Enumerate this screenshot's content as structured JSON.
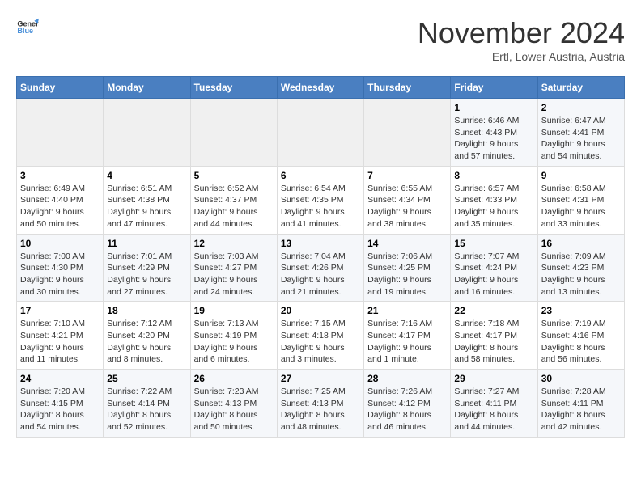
{
  "logo": {
    "line1": "General",
    "line2": "Blue"
  },
  "title": "November 2024",
  "subtitle": "Ertl, Lower Austria, Austria",
  "days_header": [
    "Sunday",
    "Monday",
    "Tuesday",
    "Wednesday",
    "Thursday",
    "Friday",
    "Saturday"
  ],
  "weeks": [
    [
      {
        "day": "",
        "info": ""
      },
      {
        "day": "",
        "info": ""
      },
      {
        "day": "",
        "info": ""
      },
      {
        "day": "",
        "info": ""
      },
      {
        "day": "",
        "info": ""
      },
      {
        "day": "1",
        "info": "Sunrise: 6:46 AM\nSunset: 4:43 PM\nDaylight: 9 hours and 57 minutes."
      },
      {
        "day": "2",
        "info": "Sunrise: 6:47 AM\nSunset: 4:41 PM\nDaylight: 9 hours and 54 minutes."
      }
    ],
    [
      {
        "day": "3",
        "info": "Sunrise: 6:49 AM\nSunset: 4:40 PM\nDaylight: 9 hours and 50 minutes."
      },
      {
        "day": "4",
        "info": "Sunrise: 6:51 AM\nSunset: 4:38 PM\nDaylight: 9 hours and 47 minutes."
      },
      {
        "day": "5",
        "info": "Sunrise: 6:52 AM\nSunset: 4:37 PM\nDaylight: 9 hours and 44 minutes."
      },
      {
        "day": "6",
        "info": "Sunrise: 6:54 AM\nSunset: 4:35 PM\nDaylight: 9 hours and 41 minutes."
      },
      {
        "day": "7",
        "info": "Sunrise: 6:55 AM\nSunset: 4:34 PM\nDaylight: 9 hours and 38 minutes."
      },
      {
        "day": "8",
        "info": "Sunrise: 6:57 AM\nSunset: 4:33 PM\nDaylight: 9 hours and 35 minutes."
      },
      {
        "day": "9",
        "info": "Sunrise: 6:58 AM\nSunset: 4:31 PM\nDaylight: 9 hours and 33 minutes."
      }
    ],
    [
      {
        "day": "10",
        "info": "Sunrise: 7:00 AM\nSunset: 4:30 PM\nDaylight: 9 hours and 30 minutes."
      },
      {
        "day": "11",
        "info": "Sunrise: 7:01 AM\nSunset: 4:29 PM\nDaylight: 9 hours and 27 minutes."
      },
      {
        "day": "12",
        "info": "Sunrise: 7:03 AM\nSunset: 4:27 PM\nDaylight: 9 hours and 24 minutes."
      },
      {
        "day": "13",
        "info": "Sunrise: 7:04 AM\nSunset: 4:26 PM\nDaylight: 9 hours and 21 minutes."
      },
      {
        "day": "14",
        "info": "Sunrise: 7:06 AM\nSunset: 4:25 PM\nDaylight: 9 hours and 19 minutes."
      },
      {
        "day": "15",
        "info": "Sunrise: 7:07 AM\nSunset: 4:24 PM\nDaylight: 9 hours and 16 minutes."
      },
      {
        "day": "16",
        "info": "Sunrise: 7:09 AM\nSunset: 4:23 PM\nDaylight: 9 hours and 13 minutes."
      }
    ],
    [
      {
        "day": "17",
        "info": "Sunrise: 7:10 AM\nSunset: 4:21 PM\nDaylight: 9 hours and 11 minutes."
      },
      {
        "day": "18",
        "info": "Sunrise: 7:12 AM\nSunset: 4:20 PM\nDaylight: 9 hours and 8 minutes."
      },
      {
        "day": "19",
        "info": "Sunrise: 7:13 AM\nSunset: 4:19 PM\nDaylight: 9 hours and 6 minutes."
      },
      {
        "day": "20",
        "info": "Sunrise: 7:15 AM\nSunset: 4:18 PM\nDaylight: 9 hours and 3 minutes."
      },
      {
        "day": "21",
        "info": "Sunrise: 7:16 AM\nSunset: 4:17 PM\nDaylight: 9 hours and 1 minute."
      },
      {
        "day": "22",
        "info": "Sunrise: 7:18 AM\nSunset: 4:17 PM\nDaylight: 8 hours and 58 minutes."
      },
      {
        "day": "23",
        "info": "Sunrise: 7:19 AM\nSunset: 4:16 PM\nDaylight: 8 hours and 56 minutes."
      }
    ],
    [
      {
        "day": "24",
        "info": "Sunrise: 7:20 AM\nSunset: 4:15 PM\nDaylight: 8 hours and 54 minutes."
      },
      {
        "day": "25",
        "info": "Sunrise: 7:22 AM\nSunset: 4:14 PM\nDaylight: 8 hours and 52 minutes."
      },
      {
        "day": "26",
        "info": "Sunrise: 7:23 AM\nSunset: 4:13 PM\nDaylight: 8 hours and 50 minutes."
      },
      {
        "day": "27",
        "info": "Sunrise: 7:25 AM\nSunset: 4:13 PM\nDaylight: 8 hours and 48 minutes."
      },
      {
        "day": "28",
        "info": "Sunrise: 7:26 AM\nSunset: 4:12 PM\nDaylight: 8 hours and 46 minutes."
      },
      {
        "day": "29",
        "info": "Sunrise: 7:27 AM\nSunset: 4:11 PM\nDaylight: 8 hours and 44 minutes."
      },
      {
        "day": "30",
        "info": "Sunrise: 7:28 AM\nSunset: 4:11 PM\nDaylight: 8 hours and 42 minutes."
      }
    ]
  ]
}
